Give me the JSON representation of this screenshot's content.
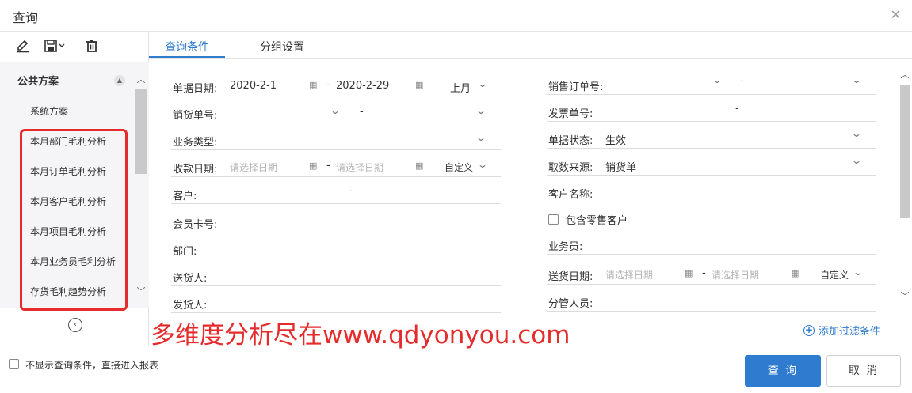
{
  "dialog": {
    "title": "查询"
  },
  "toolbar": {
    "edit_icon": "pencil-icon",
    "save_icon": "save-icon",
    "delete_icon": "trash-icon"
  },
  "sidebar": {
    "group_title": "公共方案",
    "items": [
      {
        "label": "系统方案"
      },
      {
        "label": "本月部门毛利分析"
      },
      {
        "label": "本月订单毛利分析"
      },
      {
        "label": "本月客户毛利分析"
      },
      {
        "label": "本月项目毛利分析"
      },
      {
        "label": "本月业务员毛利分析"
      },
      {
        "label": "存货毛利趋势分析"
      }
    ]
  },
  "tabs": [
    {
      "label": "查询条件"
    },
    {
      "label": "分组设置"
    }
  ],
  "form": {
    "bill_date": {
      "label": "单据日期:",
      "from": "2020-2-1",
      "to": "2020-2-29",
      "period": "上月"
    },
    "sales_order_no": {
      "label": "销售订单号:"
    },
    "delivery_no": {
      "label": "销货单号:"
    },
    "invoice_no": {
      "label": "发票单号:"
    },
    "business_type": {
      "label": "业务类型:"
    },
    "bill_status": {
      "label": "单据状态:",
      "value": "生效"
    },
    "collect_date": {
      "label": "收款日期:",
      "placeholder": "请选择日期",
      "period": "自定义"
    },
    "data_source": {
      "label": "取数来源:",
      "value": "销货单"
    },
    "customer": {
      "label": "客户:"
    },
    "customer_name": {
      "label": "客户名称:"
    },
    "member_card": {
      "label": "会员卡号:"
    },
    "include_retail": {
      "label": "包含零售客户"
    },
    "department": {
      "label": "部门:"
    },
    "salesperson": {
      "label": "业务员:"
    },
    "deliverer": {
      "label": "送货人:"
    },
    "delivery_date": {
      "label": "送货日期:",
      "placeholder": "请选择日期",
      "period": "自定义"
    },
    "shipper": {
      "label": "发货人:"
    },
    "manager": {
      "label": "分管人员:"
    },
    "dash": "-"
  },
  "add_filter": "添加过滤条件",
  "watermark": "多维度分析尽在www.qdyonyou.com",
  "footer": {
    "skip_label": "不显示查询条件，直接进入报表",
    "query_button": "查 询",
    "cancel_button": "取 消"
  },
  "colors": {
    "accent": "#2e7bcf",
    "highlight": "#e52b2b"
  }
}
